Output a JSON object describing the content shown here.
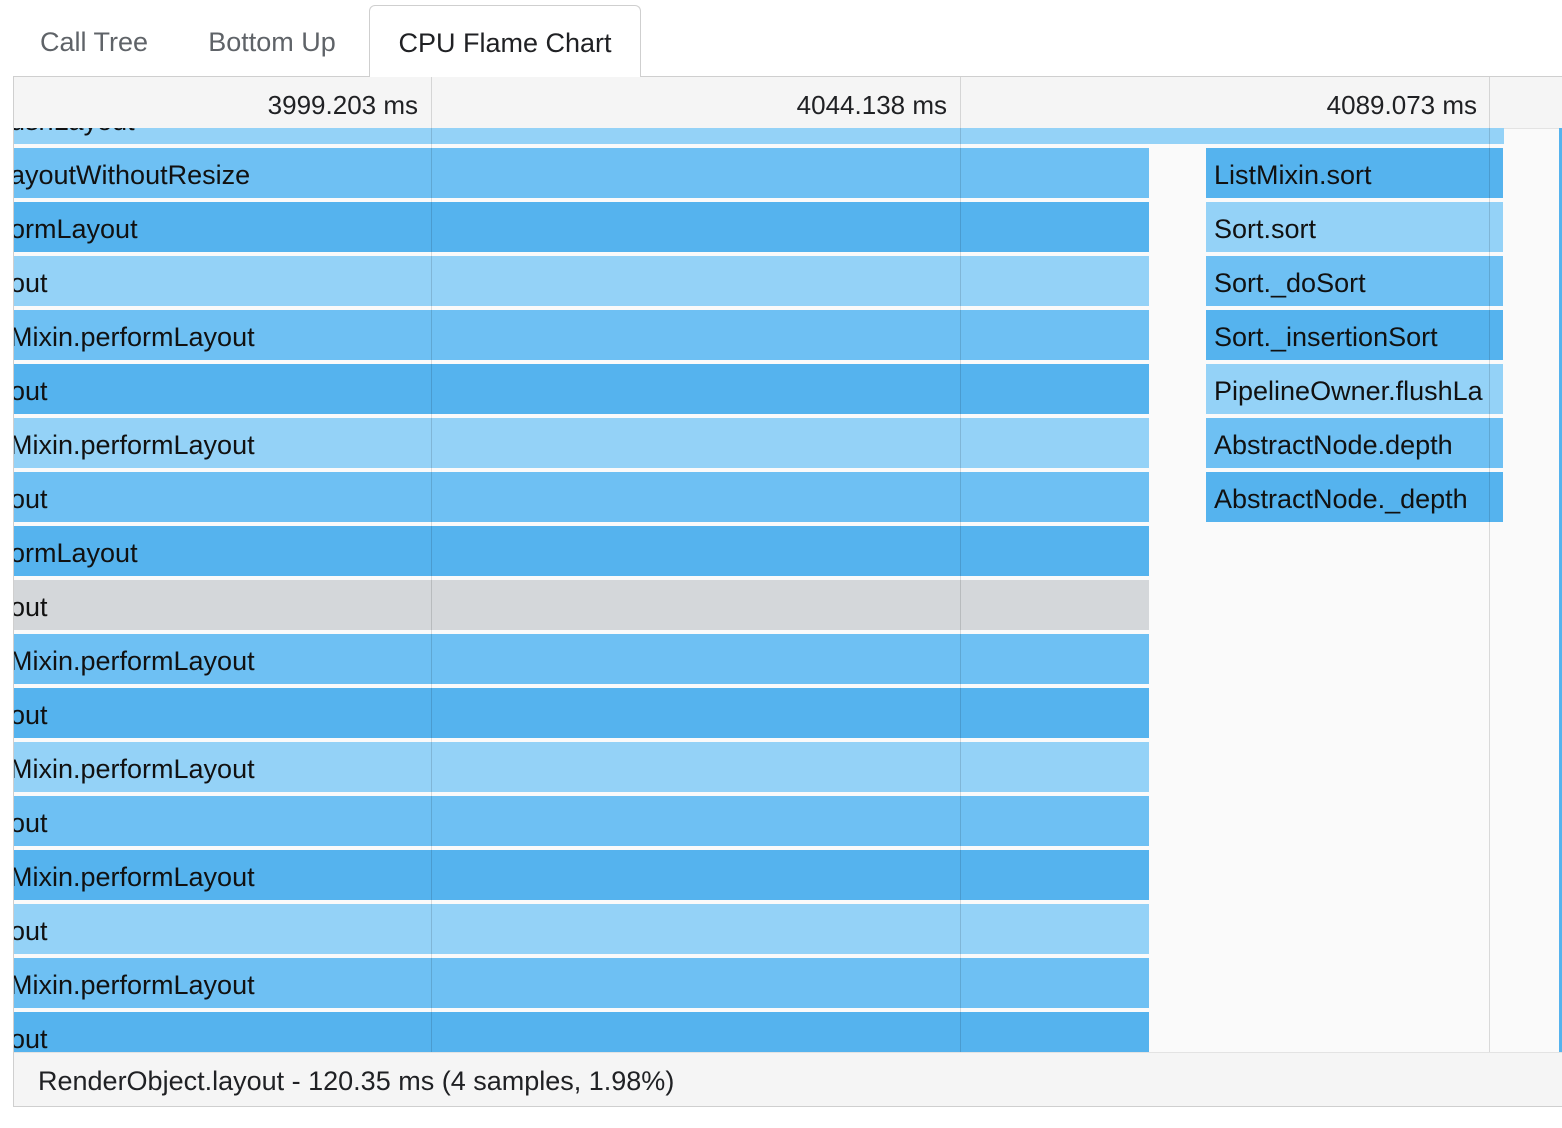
{
  "tabs": [
    {
      "label": "Call Tree",
      "active": false
    },
    {
      "label": "Bottom Up",
      "active": false
    },
    {
      "label": "CPU Flame Chart",
      "active": true
    }
  ],
  "ruler": {
    "ticks": [
      "3999.203 ms",
      "4044.138 ms",
      "4089.073 ms"
    ]
  },
  "colors": {
    "shade_light": "#94d2f7",
    "shade_mid": "#6ec0f3",
    "shade_dark": "#55b3ee",
    "selected": "#d4d7da"
  },
  "left_column_frames": [
    {
      "label": "ushLayout",
      "shade": "light"
    },
    {
      "label": "ayoutWithoutResize",
      "shade": "mid"
    },
    {
      "label": "ormLayout",
      "shade": "dark"
    },
    {
      "label": "out",
      "shade": "light"
    },
    {
      "label": "Mixin.performLayout",
      "shade": "mid"
    },
    {
      "label": "out",
      "shade": "dark"
    },
    {
      "label": "Mixin.performLayout",
      "shade": "light"
    },
    {
      "label": "out",
      "shade": "mid"
    },
    {
      "label": "ormLayout",
      "shade": "dark"
    },
    {
      "label": "out",
      "shade": "selected"
    },
    {
      "label": "Mixin.performLayout",
      "shade": "mid"
    },
    {
      "label": "out",
      "shade": "dark"
    },
    {
      "label": "Mixin.performLayout",
      "shade": "light"
    },
    {
      "label": "out",
      "shade": "mid"
    },
    {
      "label": "Mixin.performLayout",
      "shade": "dark"
    },
    {
      "label": "out",
      "shade": "light"
    },
    {
      "label": "Mixin.performLayout",
      "shade": "mid"
    },
    {
      "label": "out",
      "shade": "dark"
    }
  ],
  "right_column_frames": [
    {
      "label": "ListMixin.sort",
      "shade": "dark"
    },
    {
      "label": "Sort.sort",
      "shade": "light"
    },
    {
      "label": "Sort._doSort",
      "shade": "mid"
    },
    {
      "label": "Sort._insertionSort",
      "shade": "dark"
    },
    {
      "label": "PipelineOwner.flushLa",
      "shade": "light"
    },
    {
      "label": "AbstractNode.depth",
      "shade": "mid"
    },
    {
      "label": "AbstractNode._depth",
      "shade": "dark"
    }
  ],
  "status": {
    "text": "RenderObject.layout - 120.35 ms (4 samples, 1.98%)"
  }
}
